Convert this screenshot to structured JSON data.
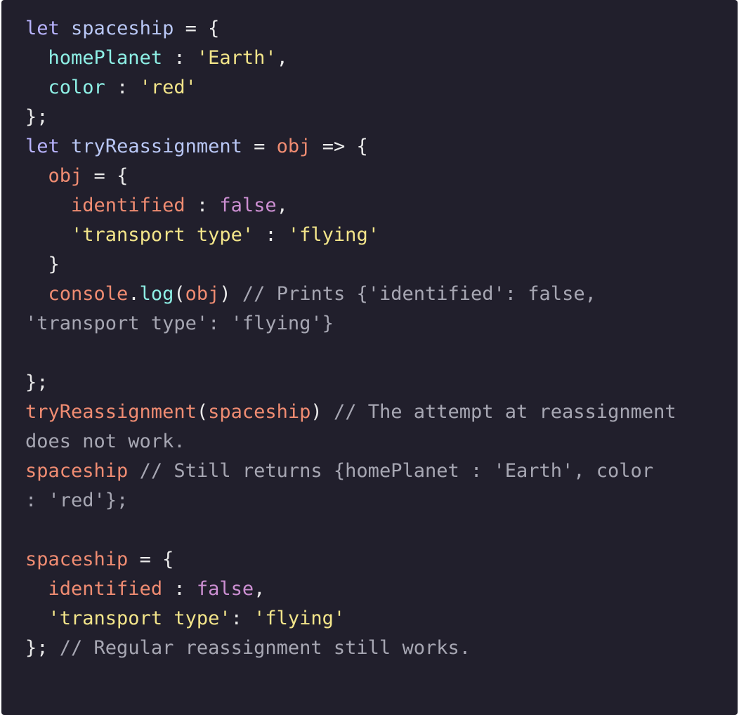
{
  "colors": {
    "background": "#211f2c",
    "keyword": "#b9b4ff",
    "identifier": "#b9c7f5",
    "plain": "#eaeaea",
    "property": "#8ef0e6",
    "string": "#f3e58a",
    "parameter": "#f08c72",
    "boolean": "#cc8fd2",
    "comment": "#a7a7b3"
  },
  "lines": [
    [
      {
        "t": "let",
        "c": "keyword"
      },
      {
        "t": " ",
        "c": "plain"
      },
      {
        "t": "spaceship",
        "c": "ident"
      },
      {
        "t": " = {",
        "c": "plain"
      }
    ],
    [
      {
        "t": "  ",
        "c": "plain"
      },
      {
        "t": "homePlanet",
        "c": "prop"
      },
      {
        "t": " : ",
        "c": "plain"
      },
      {
        "t": "'Earth'",
        "c": "string"
      },
      {
        "t": ",",
        "c": "plain"
      }
    ],
    [
      {
        "t": "  ",
        "c": "plain"
      },
      {
        "t": "color",
        "c": "prop"
      },
      {
        "t": " : ",
        "c": "plain"
      },
      {
        "t": "'red'",
        "c": "string"
      }
    ],
    [
      {
        "t": "};",
        "c": "plain"
      }
    ],
    [
      {
        "t": "let",
        "c": "keyword"
      },
      {
        "t": " ",
        "c": "plain"
      },
      {
        "t": "tryReassignment",
        "c": "ident"
      },
      {
        "t": " = ",
        "c": "plain"
      },
      {
        "t": "obj",
        "c": "param"
      },
      {
        "t": " => {",
        "c": "plain"
      }
    ],
    [
      {
        "t": "  ",
        "c": "plain"
      },
      {
        "t": "obj",
        "c": "param"
      },
      {
        "t": " = {",
        "c": "plain"
      }
    ],
    [
      {
        "t": "    ",
        "c": "plain"
      },
      {
        "t": "identified",
        "c": "param"
      },
      {
        "t": " : ",
        "c": "plain"
      },
      {
        "t": "false",
        "c": "bool"
      },
      {
        "t": ",",
        "c": "plain"
      }
    ],
    [
      {
        "t": "    ",
        "c": "plain"
      },
      {
        "t": "'transport type'",
        "c": "string"
      },
      {
        "t": " : ",
        "c": "plain"
      },
      {
        "t": "'flying'",
        "c": "string"
      }
    ],
    [
      {
        "t": "  }",
        "c": "plain"
      }
    ],
    [
      {
        "t": "  ",
        "c": "plain"
      },
      {
        "t": "console",
        "c": "param"
      },
      {
        "t": ".",
        "c": "plain"
      },
      {
        "t": "log",
        "c": "method"
      },
      {
        "t": "(",
        "c": "plain"
      },
      {
        "t": "obj",
        "c": "param"
      },
      {
        "t": ") ",
        "c": "plain"
      },
      {
        "t": "// Prints {'identified': false,",
        "c": "comment"
      }
    ],
    [
      {
        "t": "'transport type': 'flying'}",
        "c": "comment"
      }
    ],
    [],
    [
      {
        "t": "};",
        "c": "plain"
      }
    ],
    [
      {
        "t": "tryReassignment",
        "c": "param"
      },
      {
        "t": "(",
        "c": "plain"
      },
      {
        "t": "spaceship",
        "c": "param"
      },
      {
        "t": ") ",
        "c": "plain"
      },
      {
        "t": "// The attempt at reassignment",
        "c": "comment"
      }
    ],
    [
      {
        "t": "does not work.",
        "c": "comment"
      }
    ],
    [
      {
        "t": "spaceship",
        "c": "param"
      },
      {
        "t": " ",
        "c": "plain"
      },
      {
        "t": "// Still returns {homePlanet : 'Earth', color",
        "c": "comment"
      }
    ],
    [
      {
        "t": ": 'red'};",
        "c": "comment"
      }
    ],
    [],
    [
      {
        "t": "spaceship",
        "c": "param"
      },
      {
        "t": " = {",
        "c": "plain"
      }
    ],
    [
      {
        "t": "  ",
        "c": "plain"
      },
      {
        "t": "identified",
        "c": "param"
      },
      {
        "t": " : ",
        "c": "plain"
      },
      {
        "t": "false",
        "c": "bool"
      },
      {
        "t": ",",
        "c": "plain"
      }
    ],
    [
      {
        "t": "  ",
        "c": "plain"
      },
      {
        "t": "'transport type'",
        "c": "string"
      },
      {
        "t": ": ",
        "c": "plain"
      },
      {
        "t": "'flying'",
        "c": "string"
      }
    ],
    [
      {
        "t": "}; ",
        "c": "plain"
      },
      {
        "t": "// Regular reassignment still works.",
        "c": "comment"
      }
    ]
  ]
}
